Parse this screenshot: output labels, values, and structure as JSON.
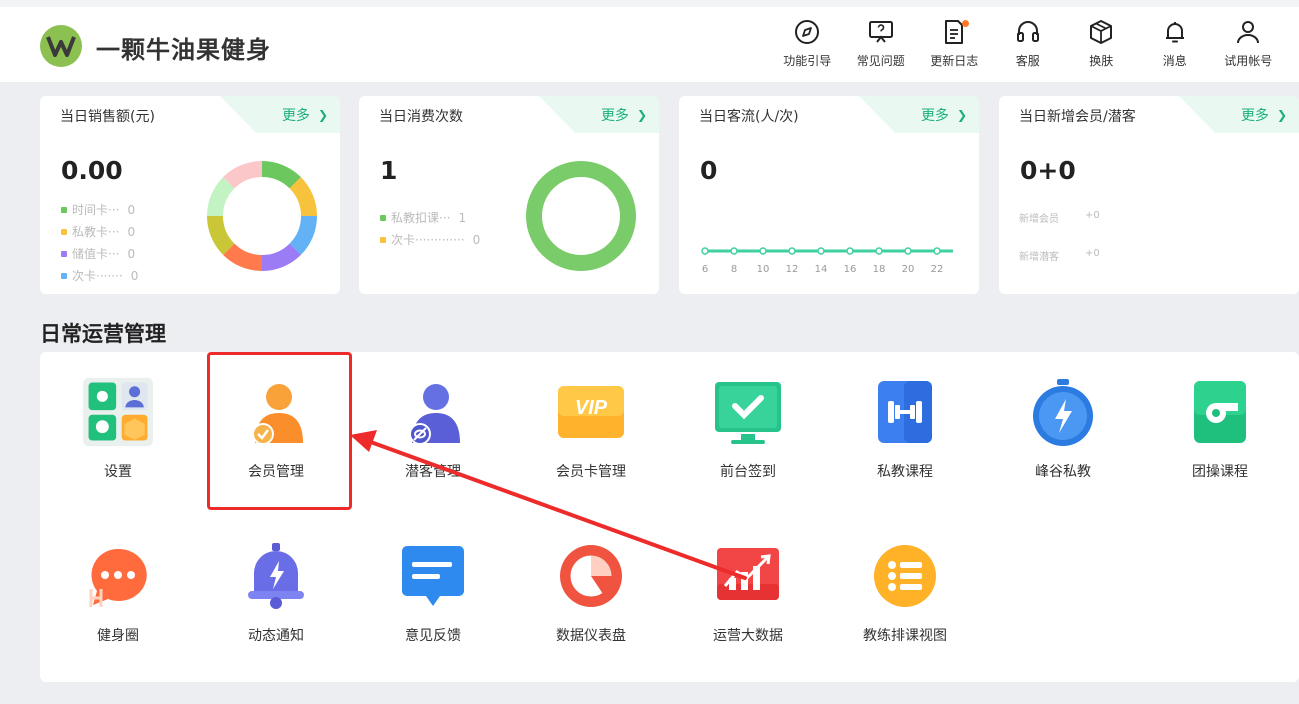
{
  "header": {
    "brand": "一颗牛油果健身",
    "nav": [
      {
        "label": "功能引导",
        "icon": "compass-icon"
      },
      {
        "label": "常见问题",
        "icon": "screen-question-icon"
      },
      {
        "label": "更新日志",
        "icon": "document-icon"
      },
      {
        "label": "客服",
        "icon": "headset-icon"
      },
      {
        "label": "换肤",
        "icon": "cube-icon"
      },
      {
        "label": "消息",
        "icon": "bell-icon"
      },
      {
        "label": "试用帐号",
        "icon": "user-icon"
      }
    ]
  },
  "cards": {
    "more_label": "更多",
    "sales": {
      "title": "当日销售额(元)",
      "value": "0.00",
      "legend": [
        {
          "label": "时间卡···",
          "value": "0",
          "color": "#6cc75e"
        },
        {
          "label": "私教卡···",
          "value": "0",
          "color": "#f8c33c"
        },
        {
          "label": "储值卡···",
          "value": "0",
          "color": "#9b7cf4"
        },
        {
          "label": "次卡·······",
          "value": "0",
          "color": "#62b2f5"
        }
      ]
    },
    "consume": {
      "title": "当日消费次数",
      "value": "1",
      "legend": [
        {
          "label": "私教扣课···",
          "value": "1",
          "color": "#6cc75e"
        },
        {
          "label": "次卡·············",
          "value": "0",
          "color": "#f8c33c"
        }
      ]
    },
    "traffic": {
      "title": "当日客流(人/次)",
      "value": "0",
      "ticks": [
        "6",
        "8",
        "10",
        "12",
        "14",
        "16",
        "18",
        "20",
        "22"
      ]
    },
    "members": {
      "title": "当日新增会员/潜客",
      "value": "0+0",
      "rows": [
        {
          "label": "新增会员",
          "value": "+0"
        },
        {
          "label": "新增潜客",
          "value": "+0"
        }
      ]
    }
  },
  "section": {
    "title": "日常运营管理",
    "apps": [
      {
        "label": "设置"
      },
      {
        "label": "会员管理"
      },
      {
        "label": "潜客管理"
      },
      {
        "label": "会员卡管理"
      },
      {
        "label": "前台签到"
      },
      {
        "label": "私教课程"
      },
      {
        "label": "峰谷私教"
      },
      {
        "label": "团操课程"
      },
      {
        "label": "健身圈"
      },
      {
        "label": "动态通知"
      },
      {
        "label": "意见反馈"
      },
      {
        "label": "数据仪表盘"
      },
      {
        "label": "运营大数据"
      },
      {
        "label": "教练排课视图"
      }
    ]
  },
  "colors": {
    "accent": "#1bb07a",
    "highlight": "#ee2b2b",
    "donut_green": "#7acb6a"
  }
}
